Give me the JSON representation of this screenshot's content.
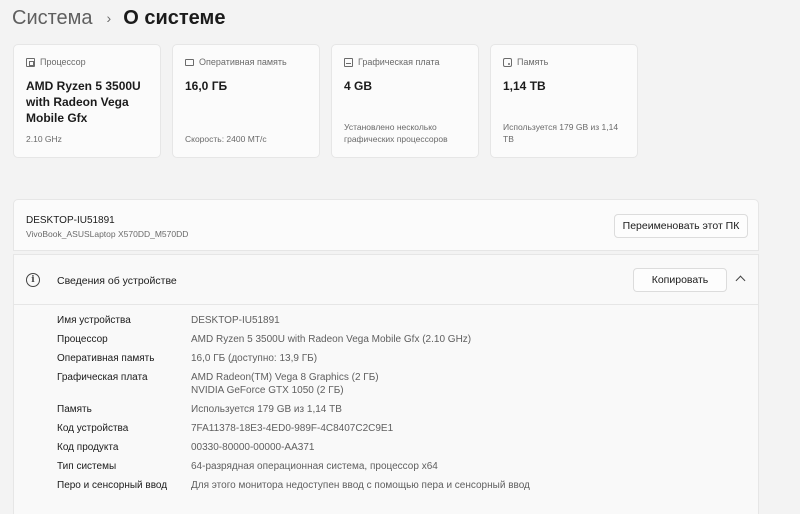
{
  "breadcrumb": {
    "parent": "Система",
    "separator": "›",
    "current": "О системе"
  },
  "cards": [
    {
      "icon": "cpu-icon",
      "label": "Процессор",
      "value": "AMD Ryzen 5 3500U with Radeon Vega Mobile Gfx",
      "note": "2.10 GHz"
    },
    {
      "icon": "ram-icon",
      "label": "Оперативная память",
      "value": "16,0 ГБ",
      "note": "Скорость: 2400 МТ/с"
    },
    {
      "icon": "gpu-icon",
      "label": "Графическая плата",
      "value": "4 GB",
      "note": "Установлено несколько графических процессоров"
    },
    {
      "icon": "storage-icon",
      "label": "Память",
      "value": "1,14 ТВ",
      "note": "Используется 179 GB из 1,14 TB"
    }
  ],
  "device": {
    "name": "DESKTOP-IU51891",
    "model": "VivoBook_ASUSLaptop X570DD_M570DD",
    "rename_label": "Переименовать этот ПК"
  },
  "specs": {
    "title": "Сведения об устройстве",
    "copy_label": "Копировать",
    "rows": [
      {
        "key": "Имя устройства",
        "values": [
          "DESKTOP-IU51891"
        ]
      },
      {
        "key": "Процессор",
        "values": [
          "AMD Ryzen 5 3500U with Radeon Vega Mobile Gfx (2.10 GHz)"
        ]
      },
      {
        "key": "Оперативная память",
        "values": [
          "16,0 ГБ (доступно: 13,9 ГБ)"
        ]
      },
      {
        "key": "Графическая плата",
        "values": [
          "AMD Radeon(TM) Vega 8 Graphics (2 ГБ)",
          "NVIDIA GeForce GTX 1050 (2 ГБ)"
        ]
      },
      {
        "key": "Память",
        "values": [
          "Используется 179 GB из 1,14 ТВ"
        ]
      },
      {
        "key": "Код устройства",
        "values": [
          "7FA11378-18E3-4ED0-989F-4C8407C2C9E1"
        ]
      },
      {
        "key": "Код продукта",
        "values": [
          "00330-80000-00000-AA371"
        ]
      },
      {
        "key": "Тип системы",
        "values": [
          "64-разрядная операционная система, процессор x64"
        ]
      },
      {
        "key": "Перо и сенсорный ввод",
        "values": [
          "Для этого монитора недоступен ввод с помощью пера и сенсорный ввод"
        ]
      }
    ]
  }
}
